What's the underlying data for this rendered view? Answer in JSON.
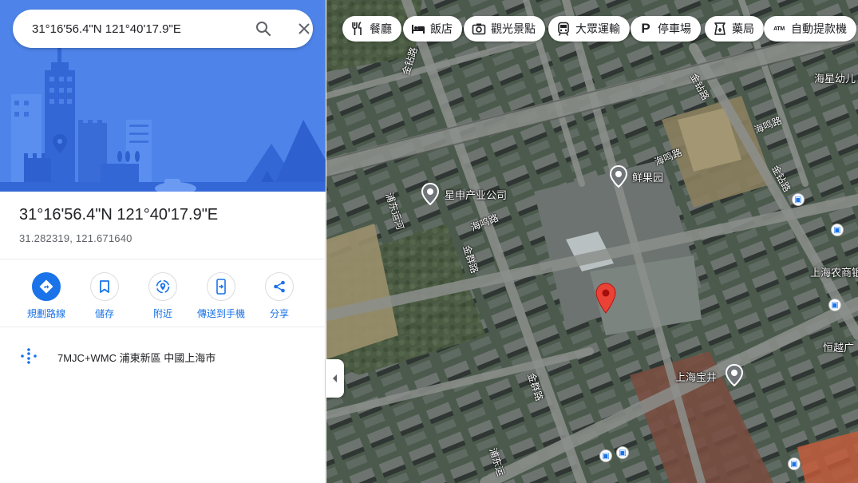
{
  "search": {
    "query": "31°16'56.4\"N 121°40'17.9\"E",
    "search_icon": "search-icon",
    "close_icon": "close-icon"
  },
  "place": {
    "title": "31°16'56.4\"N 121°40'17.9\"E",
    "decimal_coords": "31.282319, 121.671640"
  },
  "actions": [
    {
      "label": "規劃路線",
      "icon": "directions-icon"
    },
    {
      "label": "儲存",
      "icon": "bookmark-icon"
    },
    {
      "label": "附近",
      "icon": "nearby-icon"
    },
    {
      "label": "傳送到手機",
      "icon": "send-to-phone-icon"
    },
    {
      "label": "分享",
      "icon": "share-icon"
    }
  ],
  "plus_code": {
    "text": "7MJC+WMC 浦東新區 中國上海市",
    "icon": "plus-code-icon"
  },
  "chips": [
    {
      "label": "餐廳",
      "icon": "restaurant-icon"
    },
    {
      "label": "飯店",
      "icon": "hotel-icon"
    },
    {
      "label": "觀光景點",
      "icon": "camera-icon"
    },
    {
      "label": "大眾運輸",
      "icon": "transit-icon"
    },
    {
      "label": "停車場",
      "icon": "parking-icon"
    },
    {
      "label": "藥局",
      "icon": "pharmacy-icon"
    },
    {
      "label": "自動提款機",
      "icon": "atm-icon"
    }
  ],
  "map": {
    "pois": [
      {
        "label": "星申产业公司"
      },
      {
        "label": "鲜果园"
      },
      {
        "label": "上海宝井"
      }
    ],
    "place_labels": [
      "海星幼儿",
      "上海农商银",
      "恒越广"
    ],
    "road_labels": [
      "金钻路",
      "金钻路",
      "海鸣路",
      "海鸣路",
      "金钻路",
      "浦东运河",
      "海鸣路",
      "金群路",
      "金群路",
      "浦东运"
    ]
  },
  "colors": {
    "accent": "#1a73e8",
    "hero_bg": "#4f86ec",
    "pin_red": "#ea4335"
  }
}
